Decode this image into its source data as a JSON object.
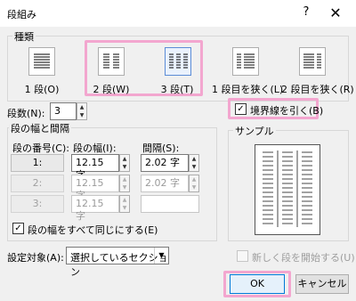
{
  "window": {
    "title": "段組み",
    "help": "?",
    "close": "✕"
  },
  "presets": {
    "legend": "種類",
    "items": [
      {
        "label": "1 段(O)",
        "icon": "one-column-icon"
      },
      {
        "label": "2 段(W)",
        "icon": "two-columns-icon"
      },
      {
        "label": "3 段(T)",
        "icon": "three-columns-icon",
        "selected": true
      },
      {
        "label": "1 段目を狭く(L)",
        "icon": "left-narrow-icon"
      },
      {
        "label": "2 段目を狭く(R)",
        "icon": "right-narrow-icon"
      }
    ]
  },
  "numColumns": {
    "label": "段数(N):",
    "value": "3"
  },
  "lineBetween": {
    "label": "境界線を引く(B)",
    "checked": true,
    "check": "✓"
  },
  "widthSpacing": {
    "legend": "段の幅と間隔",
    "headers": {
      "col": "段の番号(C):",
      "width": "段の幅(I):",
      "spacing": "間隔(S):"
    },
    "rows": [
      {
        "col": "1:",
        "width": "12.15 字",
        "spacing": "2.02 字",
        "enabled": true
      },
      {
        "col": "2:",
        "width": "12.15 字",
        "spacing": "2.02 字",
        "enabled": false
      },
      {
        "col": "3:",
        "width": "12.15 字",
        "spacing": "",
        "enabled": false
      }
    ],
    "equalWidth": {
      "label": "段の幅をすべて同じにする(E)",
      "checked": true,
      "check": "✓"
    }
  },
  "preview": {
    "legend": "サンプル"
  },
  "applyTo": {
    "label": "設定対象(A):",
    "value": "選択しているセクション"
  },
  "newColumn": {
    "label": "新しく段を開始する(U)",
    "checked": false
  },
  "buttons": {
    "ok": "OK",
    "cancel": "キャンセル"
  },
  "colors": {
    "highlight": "#f3a6cf",
    "accent": "#0078d7"
  }
}
